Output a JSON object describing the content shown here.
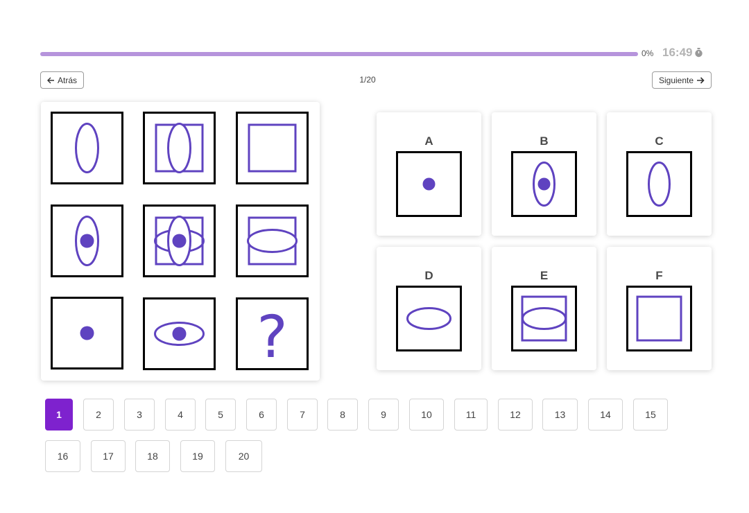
{
  "progress": {
    "percent_label": "0%",
    "fraction": 0.0,
    "fill_color": "#b694dc"
  },
  "timer": {
    "value": "16:49",
    "icon": "stopwatch-icon"
  },
  "nav": {
    "back_label": "Atrás",
    "back_icon": "arrow-left-icon",
    "next_label": "Siguiente",
    "next_icon": "arrow-right-icon",
    "counter": "1/20"
  },
  "puzzle": {
    "accent_color": "#5f43c0",
    "cells": [
      {
        "content": "vertical-ellipse"
      },
      {
        "content": "square-with-vertical-ellipse"
      },
      {
        "content": "square"
      },
      {
        "content": "vertical-ellipse-with-dot"
      },
      {
        "content": "square-with-both-ellipses-and-dot"
      },
      {
        "content": "square-with-horizontal-ellipse"
      },
      {
        "content": "dot"
      },
      {
        "content": "horizontal-ellipse-with-dot"
      },
      {
        "content": "question-mark",
        "label": "?"
      }
    ]
  },
  "options": [
    {
      "letter": "A",
      "content": "dot"
    },
    {
      "letter": "B",
      "content": "vertical-ellipse-with-dot"
    },
    {
      "letter": "C",
      "content": "vertical-ellipse"
    },
    {
      "letter": "D",
      "content": "horizontal-ellipse"
    },
    {
      "letter": "E",
      "content": "square-with-horizontal-ellipse"
    },
    {
      "letter": "F",
      "content": "square"
    }
  ],
  "questions": [
    "1",
    "2",
    "3",
    "4",
    "5",
    "6",
    "7",
    "8",
    "9",
    "10",
    "11",
    "12",
    "13",
    "14",
    "15",
    "16",
    "17",
    "18",
    "19",
    "20"
  ],
  "active_question": "1",
  "active_color": "#7e22ce"
}
